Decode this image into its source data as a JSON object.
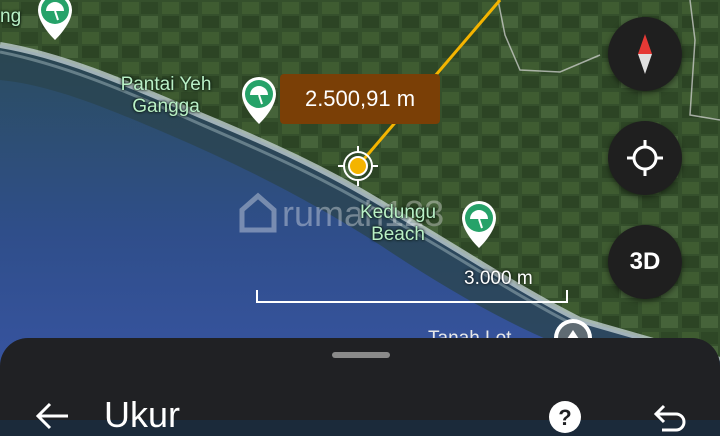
{
  "map": {
    "measure_distance": "2.500,91 m",
    "scale_label": "3.000 m",
    "watermark": "rumah123",
    "places": [
      {
        "name_line1": "Pantai Yeh",
        "name_line2": "Gangga"
      },
      {
        "name_line1": "Kedungu",
        "name_line2": "Beach"
      }
    ],
    "partial_left_label": "ng",
    "partial_bottom_label": "Tanah Lot"
  },
  "controls": {
    "compass_icon": "compass-icon",
    "location_icon": "my-location-icon",
    "three_d_label": "3D"
  },
  "sheet": {
    "title": "Ukur",
    "back_icon": "back-arrow-icon",
    "help_icon": "help-icon",
    "undo_icon": "undo-icon"
  },
  "colors": {
    "measure_line": "#f4b400",
    "distance_badge": "#7a3f06",
    "poi_marker": "#26a269",
    "sheet_bg": "#202124"
  }
}
